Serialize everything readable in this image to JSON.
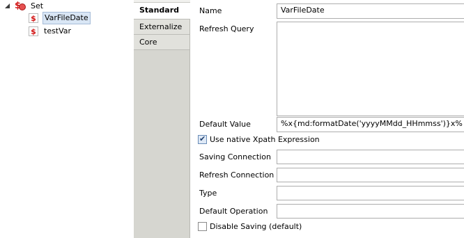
{
  "tree": {
    "root": {
      "label": "Set",
      "icon": "set-icon",
      "expanded": true
    },
    "children": [
      {
        "label": "VarFileDate",
        "icon": "variable-icon",
        "selected": true
      },
      {
        "label": "testVar",
        "icon": "variable-icon",
        "selected": false
      }
    ],
    "variable_icon_glyph": "$"
  },
  "tabs": [
    {
      "label": "Standard",
      "active": true
    },
    {
      "label": "Externalize",
      "active": false
    },
    {
      "label": "Core",
      "active": false
    }
  ],
  "form": {
    "name_label": "Name",
    "name_value": "VarFileDate",
    "refresh_query_label": "Refresh Query",
    "refresh_query_value": "",
    "default_value_label": "Default Value",
    "default_value_value": "%x{md:formatDate('yyyyMMdd_HHmmss')}x%",
    "native_xpath_label": "Use native Xpath Expression",
    "native_xpath_checked": true,
    "saving_connection_label": "Saving Connection",
    "saving_connection_value": "",
    "refresh_connection_label": "Refresh Connection",
    "refresh_connection_value": "",
    "type_label": "Type",
    "type_value": "",
    "default_operation_label": "Default Operation",
    "default_operation_value": "",
    "disable_saving_label": "Disable Saving (default)",
    "disable_saving_checked": false
  },
  "colors": {
    "variable_icon": "#d21414",
    "selection_bg": "#d9e6f5",
    "tab_bg": "#e1e1dc",
    "tab_active_bg": "#ffffff"
  }
}
